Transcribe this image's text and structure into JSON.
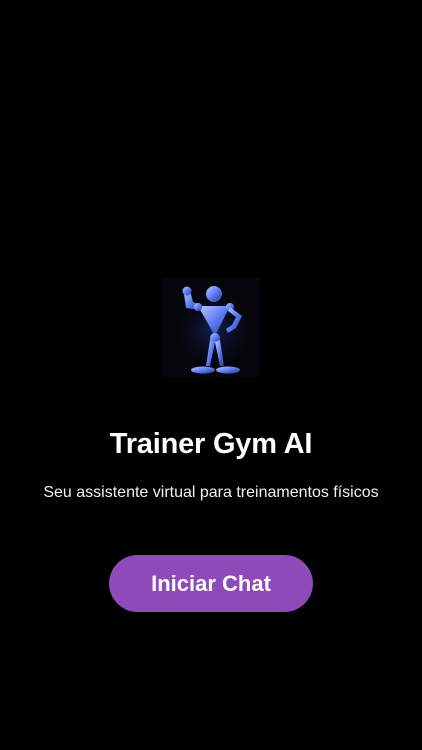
{
  "app": {
    "logo_icon": "flexing-robot-icon",
    "title": "Trainer Gym AI",
    "subtitle": "Seu assistente virtual para treinamentos físicos"
  },
  "actions": {
    "start_chat_label": "Iniciar Chat"
  },
  "colors": {
    "background": "#000000",
    "button": "#8e4ab6",
    "text": "#ffffff",
    "logo_accent": "#6f8cff"
  }
}
